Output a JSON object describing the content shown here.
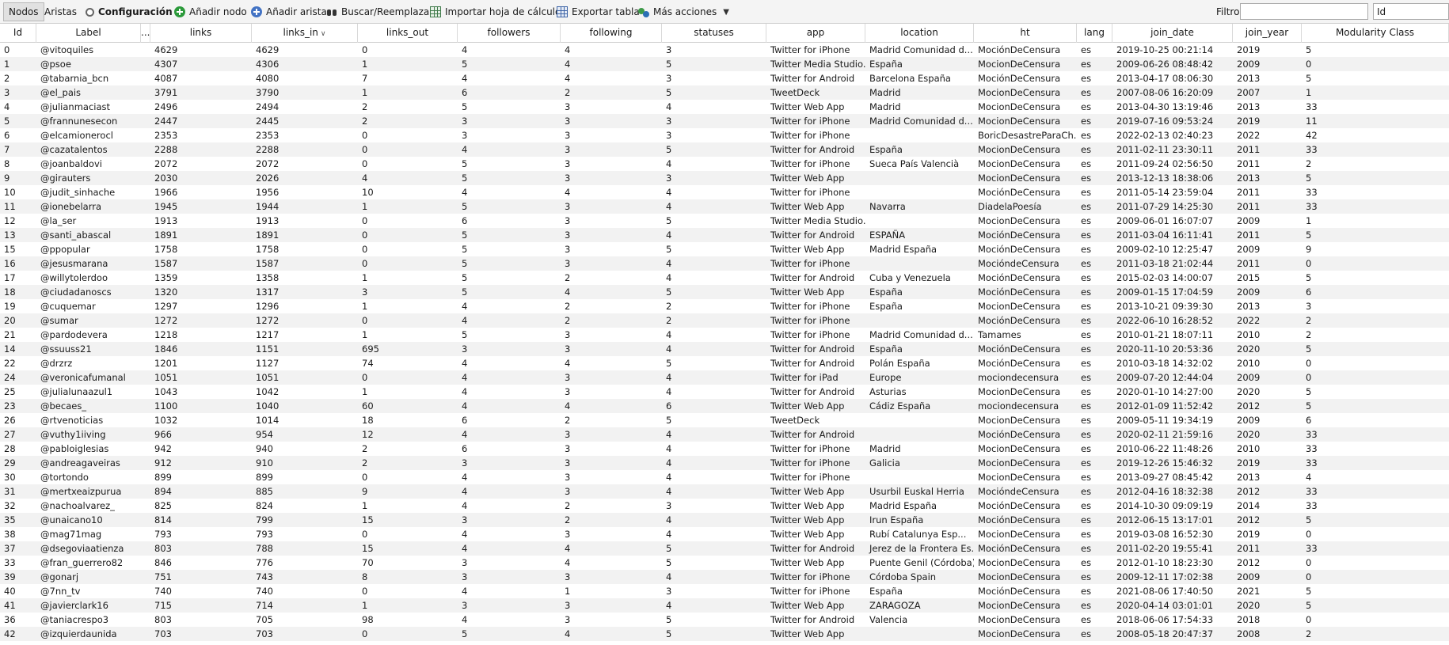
{
  "toolbar": {
    "tab_nodes": "Nodos",
    "tab_edges": "Aristas",
    "config": "Configuración",
    "add_node": "Añadir nodo",
    "add_edge": "Añadir arista",
    "search_replace": "Buscar/Reemplazar",
    "import_sheet": "Importar hoja de cálculo",
    "export_table": "Exportar tabla",
    "more_actions": "Más acciones",
    "filter_label": "Filtro:",
    "filter_value": "",
    "filter_column": "Id"
  },
  "columns": [
    "Id",
    "Label",
    "...",
    "links",
    "links_in",
    "links_out",
    "followers",
    "following",
    "statuses",
    "app",
    "location",
    "ht",
    "lang",
    "join_date",
    "join_year",
    "Modularity Class"
  ],
  "sorted_column_index": 4,
  "rows": [
    [
      "0",
      "@vitoquiles",
      "4629",
      "4629",
      "0",
      "4",
      "4",
      "3",
      "Twitter for iPhone",
      "Madrid  Comunidad d...",
      "MociónDeCensura",
      "es",
      "2019-10-25 00:21:14",
      "2019",
      "5"
    ],
    [
      "1",
      "@psoe",
      "4307",
      "4306",
      "1",
      "5",
      "4",
      "5",
      "Twitter Media Studio...",
      "España",
      "MocionDeCensura",
      "es",
      "2009-06-26 08:48:42",
      "2009",
      "0"
    ],
    [
      "2",
      "@tabarnia_bcn",
      "4087",
      "4080",
      "7",
      "4",
      "4",
      "3",
      "Twitter for Android",
      "Barcelona  España",
      "MociónDeCensura",
      "es",
      "2013-04-17 08:06:30",
      "2013",
      "5"
    ],
    [
      "3",
      "@el_pais",
      "3791",
      "3790",
      "1",
      "6",
      "2",
      "5",
      "TweetDeck",
      "Madrid",
      "MocionDeCensura",
      "es",
      "2007-08-06 16:20:09",
      "2007",
      "1"
    ],
    [
      "4",
      "@julianmaciast",
      "2496",
      "2494",
      "2",
      "5",
      "3",
      "4",
      "Twitter Web App",
      "Madrid",
      "MocionDeCensura",
      "es",
      "2013-04-30 13:19:46",
      "2013",
      "33"
    ],
    [
      "5",
      "@frannunesecon",
      "2447",
      "2445",
      "2",
      "3",
      "3",
      "3",
      "Twitter for iPhone",
      "Madrid  Comunidad d...",
      "MocionDeCensura",
      "es",
      "2019-07-16 09:53:24",
      "2019",
      "11"
    ],
    [
      "6",
      "@elcamionerocl",
      "2353",
      "2353",
      "0",
      "3",
      "3",
      "3",
      "Twitter for iPhone",
      "",
      "BoricDesastreParaCh...",
      "es",
      "2022-02-13 02:40:23",
      "2022",
      "42"
    ],
    [
      "7",
      "@cazatalentos",
      "2288",
      "2288",
      "0",
      "4",
      "3",
      "5",
      "Twitter for Android",
      "España",
      "MocionDeCensura",
      "es",
      "2011-02-11 23:30:11",
      "2011",
      "33"
    ],
    [
      "8",
      "@joanbaldovi",
      "2072",
      "2072",
      "0",
      "5",
      "3",
      "4",
      "Twitter for iPhone",
      "Sueca  País Valencià",
      "MocionDeCensura",
      "es",
      "2011-09-24 02:56:50",
      "2011",
      "2"
    ],
    [
      "9",
      "@girauters",
      "2030",
      "2026",
      "4",
      "5",
      "3",
      "3",
      "Twitter Web App",
      "",
      "MocionDeCensura",
      "es",
      "2013-12-13 18:38:06",
      "2013",
      "5"
    ],
    [
      "10",
      "@judit_sinhache",
      "1966",
      "1956",
      "10",
      "4",
      "4",
      "4",
      "Twitter for iPhone",
      "",
      "MociónDeCensura",
      "es",
      "2011-05-14 23:59:04",
      "2011",
      "33"
    ],
    [
      "11",
      "@ionebelarra",
      "1945",
      "1944",
      "1",
      "5",
      "3",
      "4",
      "Twitter Web App",
      "Navarra",
      "DiadelaPoesía",
      "es",
      "2011-07-29 14:25:30",
      "2011",
      "33"
    ],
    [
      "12",
      "@la_ser",
      "1913",
      "1913",
      "0",
      "6",
      "3",
      "5",
      "Twitter Media Studio...",
      "",
      "MocionDeCensura",
      "es",
      "2009-06-01 16:07:07",
      "2009",
      "1"
    ],
    [
      "13",
      "@santi_abascal",
      "1891",
      "1891",
      "0",
      "5",
      "3",
      "4",
      "Twitter for Android",
      "ESPAÑA",
      "MociónDeCensura",
      "es",
      "2011-03-04 16:11:41",
      "2011",
      "5"
    ],
    [
      "15",
      "@ppopular",
      "1758",
      "1758",
      "0",
      "5",
      "3",
      "5",
      "Twitter Web App",
      "Madrid  España",
      "MociónDeCensura",
      "es",
      "2009-02-10 12:25:47",
      "2009",
      "9"
    ],
    [
      "16",
      "@jesusmarana",
      "1587",
      "1587",
      "0",
      "5",
      "3",
      "4",
      "Twitter for iPhone",
      "",
      "MocióndeCensura",
      "es",
      "2011-03-18 21:02:44",
      "2011",
      "0"
    ],
    [
      "17",
      "@willytolerdoo",
      "1359",
      "1358",
      "1",
      "5",
      "2",
      "4",
      "Twitter for Android",
      "Cuba y Venezuela",
      "MociónDeCensura",
      "es",
      "2015-02-03 14:00:07",
      "2015",
      "5"
    ],
    [
      "18",
      "@ciudadanoscs",
      "1320",
      "1317",
      "3",
      "5",
      "4",
      "5",
      "Twitter Web App",
      "España",
      "MociónDeCensura",
      "es",
      "2009-01-15 17:04:59",
      "2009",
      "6"
    ],
    [
      "19",
      "@cuquemar",
      "1297",
      "1296",
      "1",
      "4",
      "2",
      "2",
      "Twitter for iPhone",
      "España",
      "MocionDeCensura",
      "es",
      "2013-10-21 09:39:30",
      "2013",
      "3"
    ],
    [
      "20",
      "@sumar",
      "1272",
      "1272",
      "0",
      "4",
      "2",
      "2",
      "Twitter for iPhone",
      "",
      "MociónDeCensura",
      "es",
      "2022-06-10 16:28:52",
      "2022",
      "2"
    ],
    [
      "21",
      "@pardodevera",
      "1218",
      "1217",
      "1",
      "5",
      "3",
      "4",
      "Twitter for iPhone",
      "Madrid  Comunidad d...",
      "Tamames",
      "es",
      "2010-01-21 18:07:11",
      "2010",
      "2"
    ],
    [
      "14",
      "@ssuuss21",
      "1846",
      "1151",
      "695",
      "3",
      "3",
      "4",
      "Twitter for Android",
      "España",
      "MociónDeCensura",
      "es",
      "2020-11-10 20:53:36",
      "2020",
      "5"
    ],
    [
      "22",
      "@drzrz",
      "1201",
      "1127",
      "74",
      "4",
      "4",
      "5",
      "Twitter for Android",
      "Polán  España",
      "MociónDeCensura",
      "es",
      "2010-03-18 14:32:02",
      "2010",
      "0"
    ],
    [
      "24",
      "@veronicafumanal",
      "1051",
      "1051",
      "0",
      "4",
      "3",
      "4",
      "Twitter for iPad",
      "Europe",
      "mociondecensura",
      "es",
      "2009-07-20 12:44:04",
      "2009",
      "0"
    ],
    [
      "25",
      "@julialunaazul1",
      "1043",
      "1042",
      "1",
      "4",
      "3",
      "4",
      "Twitter for Android",
      "Asturias",
      "MocionDeCensura",
      "es",
      "2020-01-10 14:27:00",
      "2020",
      "5"
    ],
    [
      "23",
      "@becaes_",
      "1100",
      "1040",
      "60",
      "4",
      "4",
      "6",
      "Twitter Web App",
      "Cádiz  España",
      "mociondecensura",
      "es",
      "2012-01-09 11:52:42",
      "2012",
      "5"
    ],
    [
      "26",
      "@rtvenoticias",
      "1032",
      "1014",
      "18",
      "6",
      "2",
      "5",
      "TweetDeck",
      "",
      "MocionDeCensura",
      "es",
      "2009-05-11 19:34:19",
      "2009",
      "6"
    ],
    [
      "27",
      "@vuthy1iiving",
      "966",
      "954",
      "12",
      "4",
      "3",
      "4",
      "Twitter for Android",
      "",
      "MociónDeCensura",
      "es",
      "2020-02-11 21:59:16",
      "2020",
      "33"
    ],
    [
      "28",
      "@pabloiglesias",
      "942",
      "940",
      "2",
      "6",
      "3",
      "4",
      "Twitter for iPhone",
      "Madrid",
      "MocionDeCensura",
      "es",
      "2010-06-22 11:48:26",
      "2010",
      "33"
    ],
    [
      "29",
      "@andreagaveiras",
      "912",
      "910",
      "2",
      "3",
      "3",
      "4",
      "Twitter for iPhone",
      "Galicia",
      "MocionDeCensura",
      "es",
      "2019-12-26 15:46:32",
      "2019",
      "33"
    ],
    [
      "30",
      "@tortondo",
      "899",
      "899",
      "0",
      "4",
      "3",
      "4",
      "Twitter for iPhone",
      "",
      "MocionDeCensura",
      "es",
      "2013-09-27 08:45:42",
      "2013",
      "4"
    ],
    [
      "31",
      "@mertxeaizpurua",
      "894",
      "885",
      "9",
      "4",
      "3",
      "4",
      "Twitter Web App",
      "Usurbil  Euskal Herria",
      "MocióndeCensura",
      "es",
      "2012-04-16 18:32:38",
      "2012",
      "33"
    ],
    [
      "32",
      "@nachoalvarez_",
      "825",
      "824",
      "1",
      "4",
      "2",
      "3",
      "Twitter Web App",
      "Madrid  España",
      "MociónDeCensura",
      "es",
      "2014-10-30 09:09:19",
      "2014",
      "33"
    ],
    [
      "35",
      "@unaicano10",
      "814",
      "799",
      "15",
      "3",
      "2",
      "4",
      "Twitter Web App",
      "Irun  España",
      "MociónDeCensura",
      "es",
      "2012-06-15 13:17:01",
      "2012",
      "5"
    ],
    [
      "38",
      "@mag71mag",
      "793",
      "793",
      "0",
      "4",
      "3",
      "4",
      "Twitter Web App",
      "Rubí  Catalunya  Esp...",
      "MocionDeCensura",
      "es",
      "2019-03-08 16:52:30",
      "2019",
      "0"
    ],
    [
      "37",
      "@dsegoviaatienza",
      "803",
      "788",
      "15",
      "4",
      "4",
      "5",
      "Twitter for Android",
      "Jerez de la Frontera  Es...",
      "MociónDeCensura",
      "es",
      "2011-02-20 19:55:41",
      "2011",
      "33"
    ],
    [
      "33",
      "@fran_guerrero82",
      "846",
      "776",
      "70",
      "3",
      "4",
      "5",
      "Twitter Web App",
      "Puente Genil (Córdoba)",
      "MocionDeCensura",
      "es",
      "2012-01-10 18:23:30",
      "2012",
      "0"
    ],
    [
      "39",
      "@gonarj",
      "751",
      "743",
      "8",
      "3",
      "3",
      "4",
      "Twitter for iPhone",
      "Córdoba  Spain",
      "MocionDeCensura",
      "es",
      "2009-12-11 17:02:38",
      "2009",
      "0"
    ],
    [
      "40",
      "@7nn_tv",
      "740",
      "740",
      "0",
      "4",
      "1",
      "3",
      "Twitter for iPhone",
      "España",
      "MociónDeCensura",
      "es",
      "2021-08-06 17:40:50",
      "2021",
      "5"
    ],
    [
      "41",
      "@javierclark16",
      "715",
      "714",
      "1",
      "3",
      "3",
      "4",
      "Twitter Web App",
      "ZARAGOZA",
      "MocionDeCensura",
      "es",
      "2020-04-14 03:01:01",
      "2020",
      "5"
    ],
    [
      "36",
      "@taniacrespo3",
      "803",
      "705",
      "98",
      "4",
      "3",
      "5",
      "Twitter for Android",
      "Valencia",
      "MocionDeCensura",
      "es",
      "2018-06-06 17:54:33",
      "2018",
      "0"
    ],
    [
      "42",
      "@izquierdaunida",
      "703",
      "703",
      "0",
      "5",
      "4",
      "5",
      "Twitter Web App",
      "",
      "MocionDeCensura",
      "es",
      "2008-05-18 20:47:37",
      "2008",
      "2"
    ]
  ]
}
